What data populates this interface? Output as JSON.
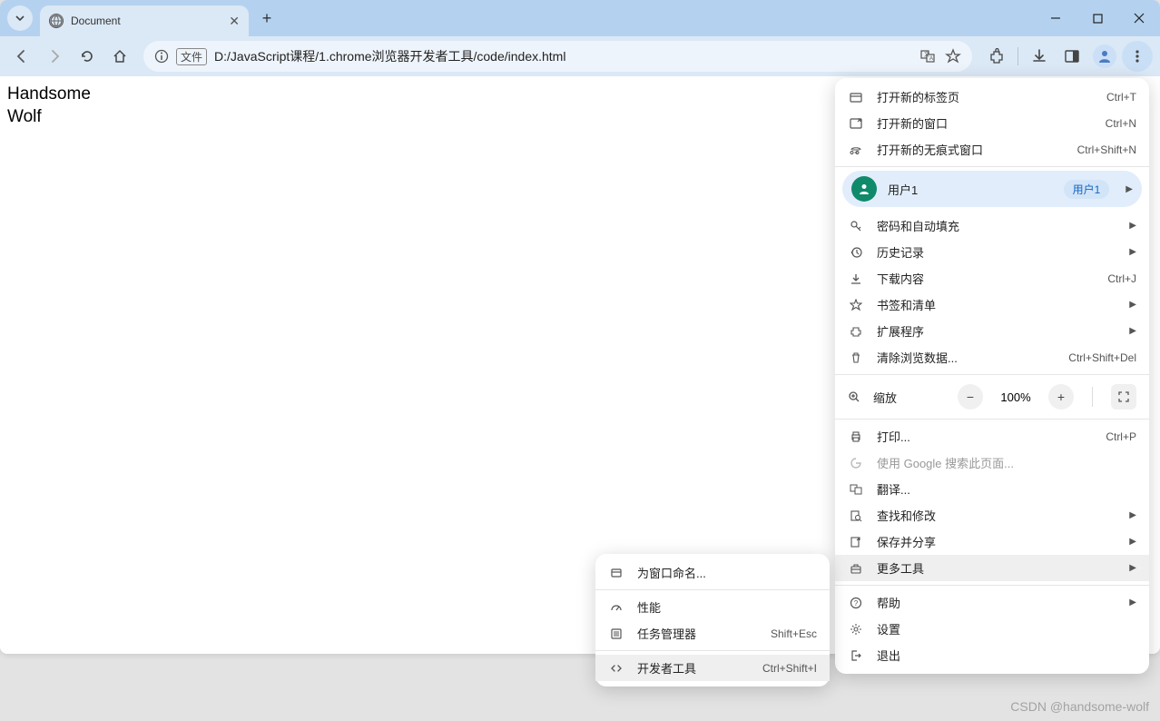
{
  "tab": {
    "title": "Document"
  },
  "addressbar": {
    "scheme_label": "文件",
    "url": "D:/JavaScript课程/1.chrome浏览器开发者工具/code/index.html"
  },
  "page_content": {
    "line1": "Handsome",
    "line2": "Wolf"
  },
  "main_menu": {
    "new_tab": {
      "label": "打开新的标签页",
      "shortcut": "Ctrl+T"
    },
    "new_window": {
      "label": "打开新的窗口",
      "shortcut": "Ctrl+N"
    },
    "incognito": {
      "label": "打开新的无痕式窗口",
      "shortcut": "Ctrl+Shift+N"
    },
    "user": {
      "label": "用户1",
      "badge": "用户1"
    },
    "passwords": {
      "label": "密码和自动填充"
    },
    "history": {
      "label": "历史记录"
    },
    "downloads": {
      "label": "下载内容",
      "shortcut": "Ctrl+J"
    },
    "bookmarks": {
      "label": "书签和清单"
    },
    "extensions": {
      "label": "扩展程序"
    },
    "clear_data": {
      "label": "清除浏览数据...",
      "shortcut": "Ctrl+Shift+Del"
    },
    "zoom": {
      "label": "缩放",
      "value": "100%"
    },
    "print": {
      "label": "打印...",
      "shortcut": "Ctrl+P"
    },
    "google_search": {
      "label": "使用 Google 搜索此页面..."
    },
    "translate": {
      "label": "翻译..."
    },
    "find_edit": {
      "label": "查找和修改"
    },
    "save_share": {
      "label": "保存并分享"
    },
    "more_tools": {
      "label": "更多工具"
    },
    "help": {
      "label": "帮助"
    },
    "settings": {
      "label": "设置"
    },
    "exit": {
      "label": "退出"
    }
  },
  "sub_menu": {
    "name_window": {
      "label": "为窗口命名..."
    },
    "performance": {
      "label": "性能"
    },
    "task_manager": {
      "label": "任务管理器",
      "shortcut": "Shift+Esc"
    },
    "dev_tools": {
      "label": "开发者工具",
      "shortcut": "Ctrl+Shift+I"
    }
  },
  "watermark": "CSDN @handsome-wolf"
}
